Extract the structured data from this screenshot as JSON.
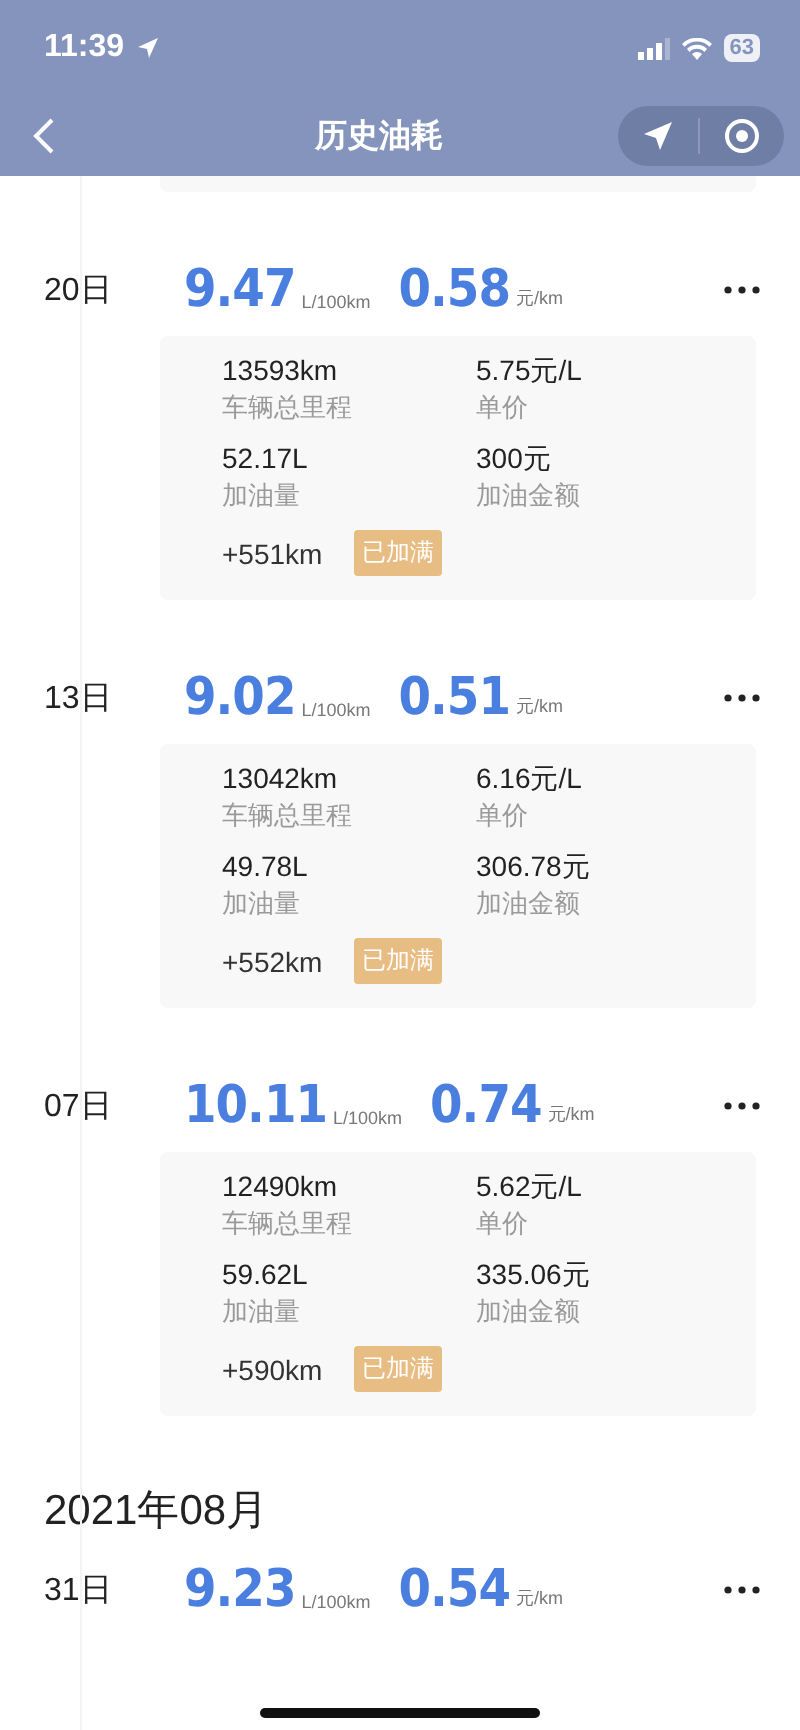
{
  "status_bar": {
    "time": "11:39",
    "battery": "63"
  },
  "nav": {
    "title": "历史油耗"
  },
  "groups": [
    {
      "entries": [
        {
          "day": "20日",
          "consumption": "9.47",
          "consumption_unit": "L/100km",
          "cost": "0.58",
          "cost_unit": "元/km",
          "card": {
            "mileage": "13593km",
            "mileage_label": "车辆总里程",
            "price": "5.75元/L",
            "price_label": "单价",
            "volume": "52.17L",
            "volume_label": "加油量",
            "amount": "300元",
            "amount_label": "加油金额",
            "distance": "+551km",
            "badge": "已加满"
          }
        },
        {
          "day": "13日",
          "consumption": "9.02",
          "consumption_unit": "L/100km",
          "cost": "0.51",
          "cost_unit": "元/km",
          "card": {
            "mileage": "13042km",
            "mileage_label": "车辆总里程",
            "price": "6.16元/L",
            "price_label": "单价",
            "volume": "49.78L",
            "volume_label": "加油量",
            "amount": "306.78元",
            "amount_label": "加油金额",
            "distance": "+552km",
            "badge": "已加满"
          }
        },
        {
          "day": "07日",
          "consumption": "10.11",
          "consumption_unit": "L/100km",
          "cost": "0.74",
          "cost_unit": "元/km",
          "card": {
            "mileage": "12490km",
            "mileage_label": "车辆总里程",
            "price": "5.62元/L",
            "price_label": "单价",
            "volume": "59.62L",
            "volume_label": "加油量",
            "amount": "335.06元",
            "amount_label": "加油金额",
            "distance": "+590km",
            "badge": "已加满"
          }
        }
      ]
    },
    {
      "month": "2021年08月",
      "entries": [
        {
          "day": "31日",
          "consumption": "9.23",
          "consumption_unit": "L/100km",
          "cost": "0.54",
          "cost_unit": "元/km"
        }
      ]
    }
  ]
}
